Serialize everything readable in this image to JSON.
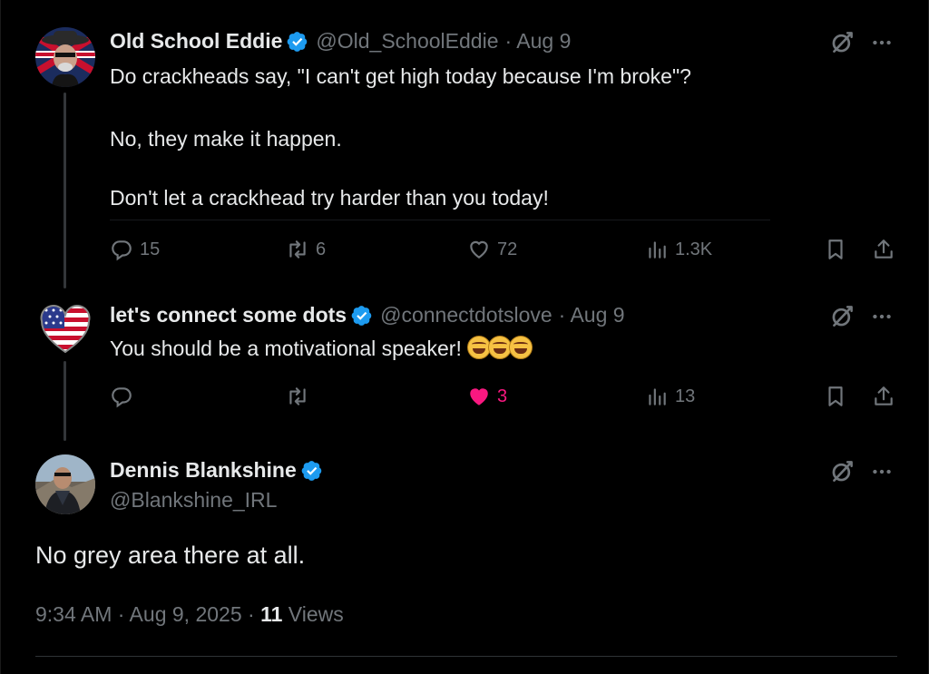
{
  "tweets": [
    {
      "name": "Old School Eddie",
      "handle": "@Old_SchoolEddie",
      "date": "· Aug 9",
      "lines": [
        "Do crackheads say, \"I can't get high today because I'm broke\"?",
        "No, they make it happen.",
        "Don't let a crackhead try harder than you today!"
      ],
      "replies": "15",
      "reposts": "6",
      "likes": "72",
      "views": "1.3K"
    },
    {
      "name": "let's connect some dots",
      "handle": "@connectdotslove",
      "date": "· Aug 9",
      "text": "You should be a motivational speaker!",
      "emojis": [
        "rolling-on-floor-laughing",
        "rolling-on-floor-laughing",
        "rolling-on-floor-laughing"
      ],
      "likes": "3",
      "views": "13"
    }
  ],
  "main_post": {
    "name": "Dennis Blankshine",
    "handle": "@Blankshine_IRL",
    "text": "No grey area there at all.",
    "time": "9:34 AM",
    "date": "· Aug 9, 2025 ·",
    "views_count": "11",
    "views_label": "Views"
  },
  "colors": {
    "background": "#000000",
    "text": "#e7e9ea",
    "muted": "#71767b",
    "verified": "#1d9bf0",
    "like_active": "#f91880"
  },
  "icons": [
    "verified-badge-icon",
    "grok-icon",
    "more-icon",
    "reply-icon",
    "repost-icon",
    "like-icon",
    "views-icon",
    "bookmark-icon",
    "share-icon"
  ]
}
